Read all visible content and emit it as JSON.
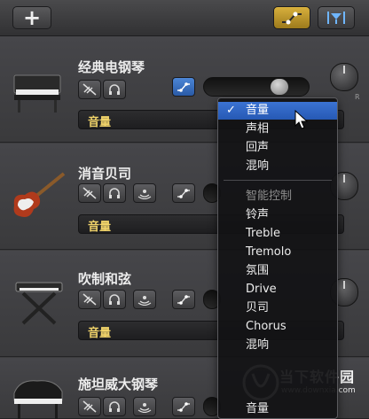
{
  "toolbar": {
    "add_label": "+"
  },
  "tracks": [
    {
      "name": "经典电钢琴",
      "dropdown": "音量",
      "pan_right_label": "R"
    },
    {
      "name": "消音贝司",
      "dropdown": "音量"
    },
    {
      "name": "吹制和弦",
      "dropdown": "音量"
    },
    {
      "name": "施坦威大钢琴"
    }
  ],
  "menu": {
    "items": [
      {
        "label": "音量",
        "selected": true,
        "check": "✓"
      },
      {
        "label": "声相"
      },
      {
        "label": "回声"
      },
      {
        "label": "混响"
      }
    ],
    "section_header": "智能控制",
    "smart_items": [
      "铃声",
      "Treble",
      "Tremolo",
      "氛围",
      "Drive",
      "贝司",
      "Chorus",
      "混响"
    ],
    "trailing_item": "音量"
  },
  "watermark": {
    "title": "当下软件园",
    "url": "www.downxia.com"
  },
  "colors": {
    "accent_yellow": "#f0d36a",
    "selection_blue": "#2f67c7",
    "automation_gold": "#c9a233"
  }
}
